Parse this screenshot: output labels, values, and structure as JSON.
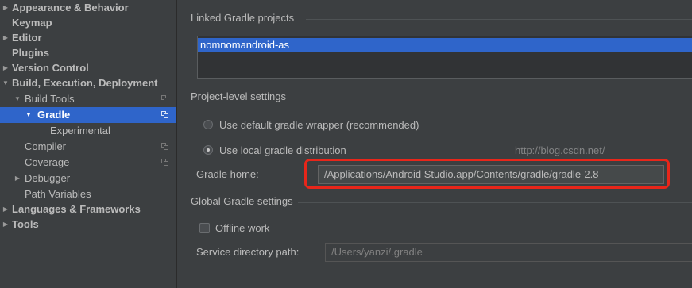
{
  "sidebar": {
    "items": [
      {
        "label": "Appearance & Behavior",
        "arrow": "▶"
      },
      {
        "label": "Keymap",
        "arrow": ""
      },
      {
        "label": "Editor",
        "arrow": "▶"
      },
      {
        "label": "Plugins",
        "arrow": ""
      },
      {
        "label": "Version Control",
        "arrow": "▶"
      },
      {
        "label": "Build, Execution, Deployment",
        "arrow": "▼"
      },
      {
        "label": "Build Tools",
        "arrow": "▼"
      },
      {
        "label": "Gradle",
        "arrow": "▼"
      },
      {
        "label": "Experimental",
        "arrow": ""
      },
      {
        "label": "Compiler",
        "arrow": ""
      },
      {
        "label": "Coverage",
        "arrow": ""
      },
      {
        "label": "Debugger",
        "arrow": "▶"
      },
      {
        "label": "Path Variables",
        "arrow": ""
      },
      {
        "label": "Languages & Frameworks",
        "arrow": "▶"
      },
      {
        "label": "Tools",
        "arrow": "▶"
      }
    ]
  },
  "main": {
    "linked_projects_title": "Linked Gradle projects",
    "linked_projects": [
      "nomnomandroid-as"
    ],
    "project_level_title": "Project-level settings",
    "radio_wrapper_label": "Use default gradle wrapper (recommended)",
    "radio_local_label": "Use local gradle distribution",
    "gradle_home_label": "Gradle home:",
    "gradle_home_value": "/Applications/Android Studio.app/Contents/gradle/gradle-2.8",
    "global_title": "Global Gradle settings",
    "offline_label": "Offline work",
    "service_dir_label": "Service directory path:",
    "service_dir_value": "/Users/yanzi/.gradle",
    "watermark": "http://blog.csdn.net/"
  },
  "colors": {
    "background": "#3c3f41",
    "selection": "#2f65ca",
    "highlight": "#e8261a"
  }
}
